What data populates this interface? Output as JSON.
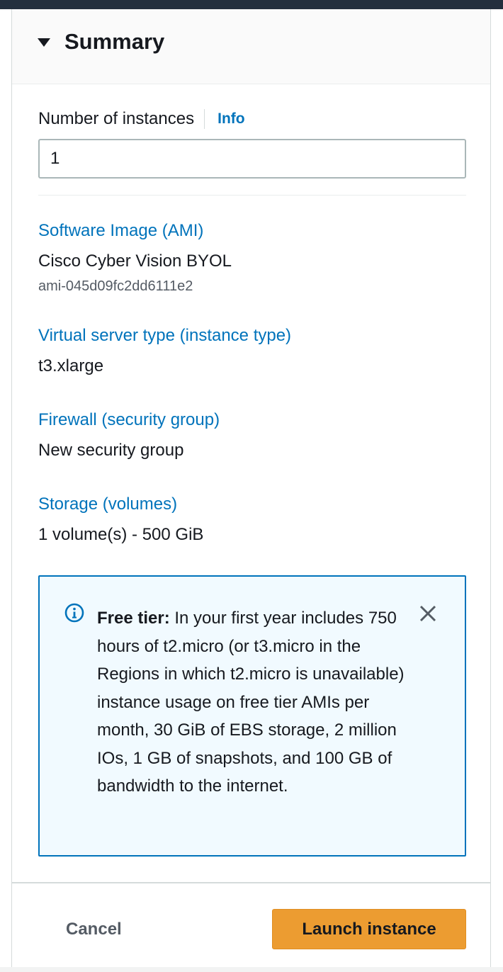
{
  "summary": {
    "title": "Summary"
  },
  "instances": {
    "label": "Number of instances",
    "info_label": "Info",
    "value": "1"
  },
  "ami": {
    "label": "Software Image (AMI)",
    "name": "Cisco Cyber Vision BYOL",
    "id": "ami-045d09fc2dd6111e2"
  },
  "instance_type": {
    "label": "Virtual server type (instance type)",
    "value": "t3.xlarge"
  },
  "firewall": {
    "label": "Firewall (security group)",
    "value": "New security group"
  },
  "storage": {
    "label": "Storage (volumes)",
    "value": "1 volume(s) - 500 GiB"
  },
  "free_tier": {
    "heading": "Free tier:",
    "body": " In your first year includes 750 hours of t2.micro (or t3.micro in the Regions in which t2.micro is unavailable) instance usage on free tier AMIs per month, 30 GiB of EBS storage, 2 million IOs, 1 GB of snapshots, and 100 GB of bandwidth to the internet."
  },
  "footer": {
    "cancel_label": "Cancel",
    "launch_label": "Launch instance"
  },
  "icons": {
    "collapse": "caret-down-icon",
    "info": "info-circle-icon",
    "close": "close-icon"
  },
  "colors": {
    "link": "#0073bb",
    "primary_button": "#ec9c31",
    "alert_background": "#f1faff",
    "alert_border": "#0073bb",
    "header_bar": "#232f3e"
  }
}
